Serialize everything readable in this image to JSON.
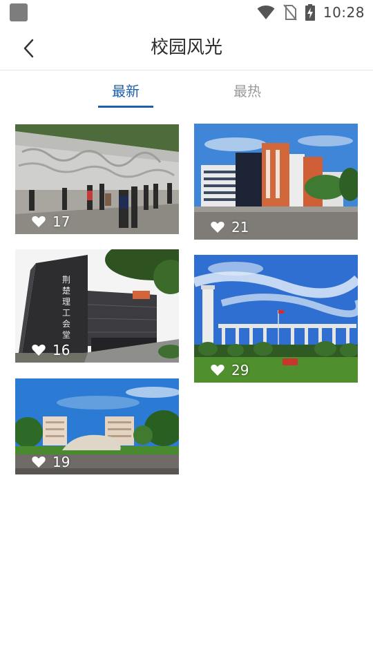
{
  "status_bar": {
    "time": "10:28",
    "icons": [
      "app-icon",
      "wifi-icon",
      "no-sim-icon",
      "battery-charging-icon"
    ]
  },
  "header": {
    "back_icon": "chevron-left-icon",
    "title": "校园风光"
  },
  "tabs": [
    {
      "label": "最新",
      "active": true
    },
    {
      "label": "最热",
      "active": false
    }
  ],
  "colors": {
    "accent": "#1c5fad",
    "tab_inactive": "#9a9a9a"
  },
  "photos": [
    {
      "scene": "stone-relief-wall-with-visitors",
      "likes": "17"
    },
    {
      "scene": "office-buildings-blue-sky",
      "likes": "21"
    },
    {
      "scene": "dark-hall-building",
      "likes": "16",
      "sign_text": "荆楚理工会堂"
    },
    {
      "scene": "tower-and-colonnade-plaza",
      "likes": "29"
    },
    {
      "scene": "campus-stone-and-residences",
      "likes": "19"
    }
  ]
}
